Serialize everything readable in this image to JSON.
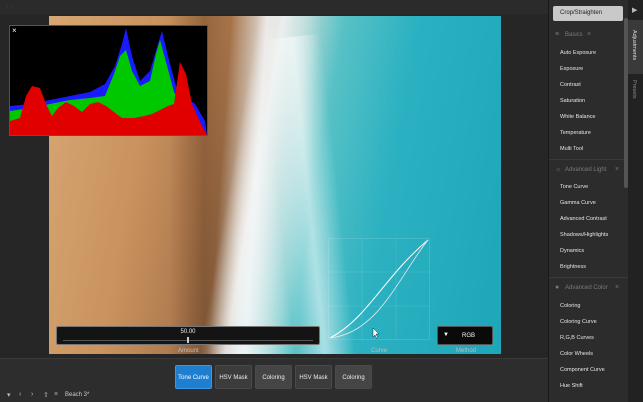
{
  "topbar": {
    "dots": "· ·"
  },
  "histogram": {
    "close_glyph": "×"
  },
  "controls": {
    "amount_value": "50.00",
    "amount_label": "Amount",
    "curve_label": "Curve",
    "method_value": "RGB",
    "method_label": "Method"
  },
  "tools": [
    {
      "label": "Tone Curve",
      "state": "active"
    },
    {
      "label": "HSV Mask",
      "state": "normal"
    },
    {
      "label": "Coloring",
      "state": "muted"
    },
    {
      "label": "HSV Mask",
      "state": "normal"
    },
    {
      "label": "Coloring",
      "state": "muted"
    }
  ],
  "statusbar": {
    "filename": "Beach 3*"
  },
  "panel": {
    "crop_button": "Crop/Straighten",
    "sections": [
      {
        "title": "Basics",
        "icon": "sliders-icon",
        "items": [
          "Auto Exposure",
          "Exposure",
          "Contrast",
          "Saturation",
          "White Balance",
          "Temperature",
          "Multi Tool"
        ]
      },
      {
        "title": "Advanced Light",
        "icon": "sun-icon",
        "items": [
          "Tone Curve",
          "Gamma Curve",
          "Advanced Contrast",
          "Shadows/Highlights",
          "Dynamics",
          "Brightness"
        ]
      },
      {
        "title": "Advanced Color",
        "icon": "palette-icon",
        "items": [
          "Coloring",
          "Coloring Curve",
          "R,G,B Curves",
          "Color Wheels",
          "Component Curve",
          "Hue Shift"
        ]
      }
    ]
  },
  "vtabs": {
    "adjustments": "Adjustments",
    "presets": "Presets"
  },
  "colors": {
    "accent": "#1e7fd0",
    "histogram_red": "#e00000",
    "histogram_green": "#00c800",
    "histogram_blue": "#1a1aff"
  }
}
